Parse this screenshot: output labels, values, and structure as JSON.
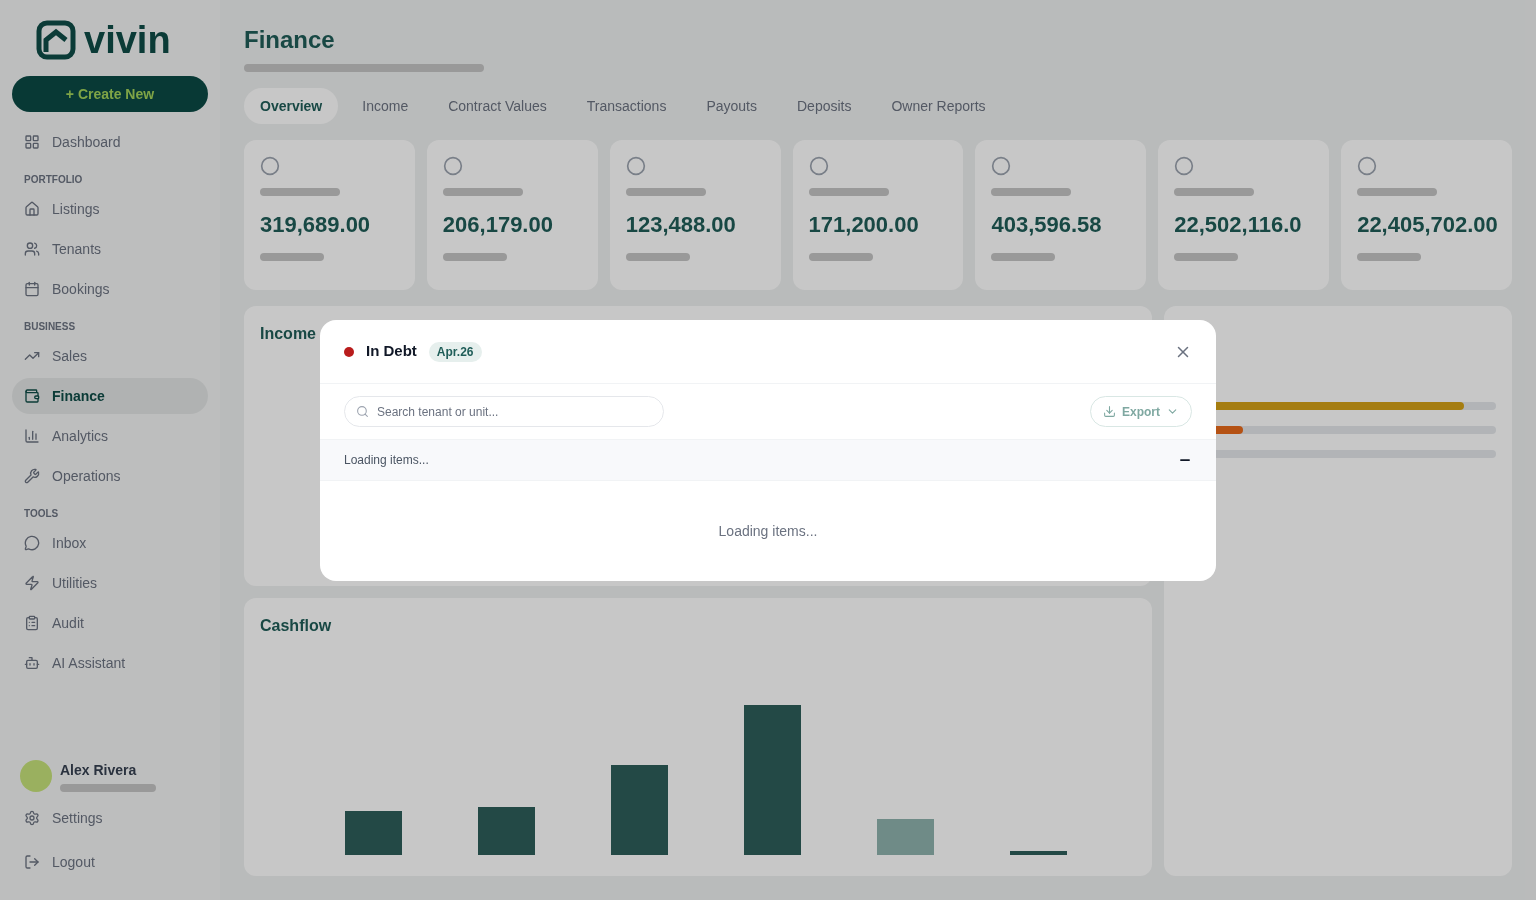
{
  "sidebar": {
    "logo": "vivin",
    "create_button": "+ Create New",
    "sections": [
      {
        "items": [
          {
            "label": "Dashboard",
            "selected": false
          }
        ]
      },
      {
        "heading": "PORTFOLIO",
        "items": [
          {
            "label": "Listings",
            "selected": false
          },
          {
            "label": "Tenants",
            "selected": false
          },
          {
            "label": "Bookings",
            "selected": false
          }
        ]
      },
      {
        "heading": "BUSINESS",
        "items": [
          {
            "label": "Sales",
            "selected": false
          },
          {
            "label": "Finance",
            "selected": true
          },
          {
            "label": "Analytics",
            "selected": false
          },
          {
            "label": "Operations",
            "selected": false
          }
        ]
      },
      {
        "heading": "TOOLS",
        "items": [
          {
            "label": "Inbox",
            "selected": false
          },
          {
            "label": "Utilities",
            "selected": false
          },
          {
            "label": "Audit",
            "selected": false
          },
          {
            "label": "AI Assistant",
            "selected": false
          }
        ]
      }
    ],
    "user": {
      "name": "Alex Rivera"
    },
    "footer_items": [
      "Settings",
      "Logout"
    ]
  },
  "page": {
    "title": "Finance",
    "tabs": [
      {
        "label": "Overview",
        "selected": true
      },
      {
        "label": "Income",
        "selected": false
      },
      {
        "label": "Contract Values",
        "selected": false
      },
      {
        "label": "Transactions",
        "selected": false
      },
      {
        "label": "Payouts",
        "selected": false
      },
      {
        "label": "Deposits",
        "selected": false
      },
      {
        "label": "Owner Reports",
        "selected": false
      }
    ],
    "cards": [
      {
        "value": "319,689.00"
      },
      {
        "value": "206,179.00"
      },
      {
        "value": "123,488.00"
      },
      {
        "value": "171,200.00"
      },
      {
        "value": "403,596.58"
      },
      {
        "value": "22,502,116.0"
      },
      {
        "value": "22,405,702.00"
      }
    ],
    "panels": [
      "Income",
      "Cashflow"
    ]
  },
  "modal": {
    "status_dot": {
      "color": "#b91c1c"
    },
    "title": "In Debt",
    "badge": "Apr.26",
    "search": {
      "placeholder": "Search tenant or unit..."
    },
    "export_button": "Export",
    "group": {
      "label": "Loading items...",
      "expanded": true
    },
    "body_text": "Loading items..."
  }
}
